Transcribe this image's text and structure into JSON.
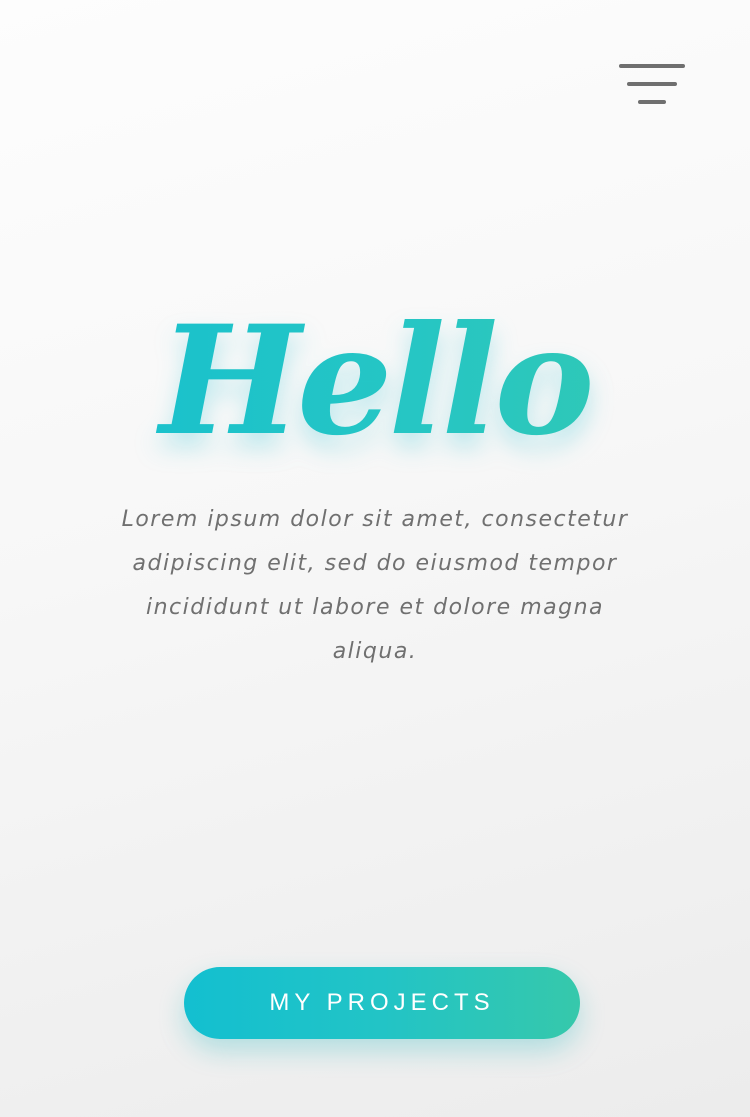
{
  "header": {
    "menu_icon": "hamburger-menu-icon"
  },
  "hero": {
    "title": "Hello",
    "description": "Lorem ipsum dolor sit amet, consectetur adipiscing elit, sed do eiusmod tempor incididunt ut labore et dolore magna aliqua."
  },
  "cta": {
    "label": "MY PROJECTS"
  },
  "colors": {
    "accent_start": "#13bfd0",
    "accent_end": "#36c8ab",
    "icon": "#6f6f6f",
    "text": "#707070",
    "background": "#f7f7f7",
    "button_text": "#ffffff"
  }
}
